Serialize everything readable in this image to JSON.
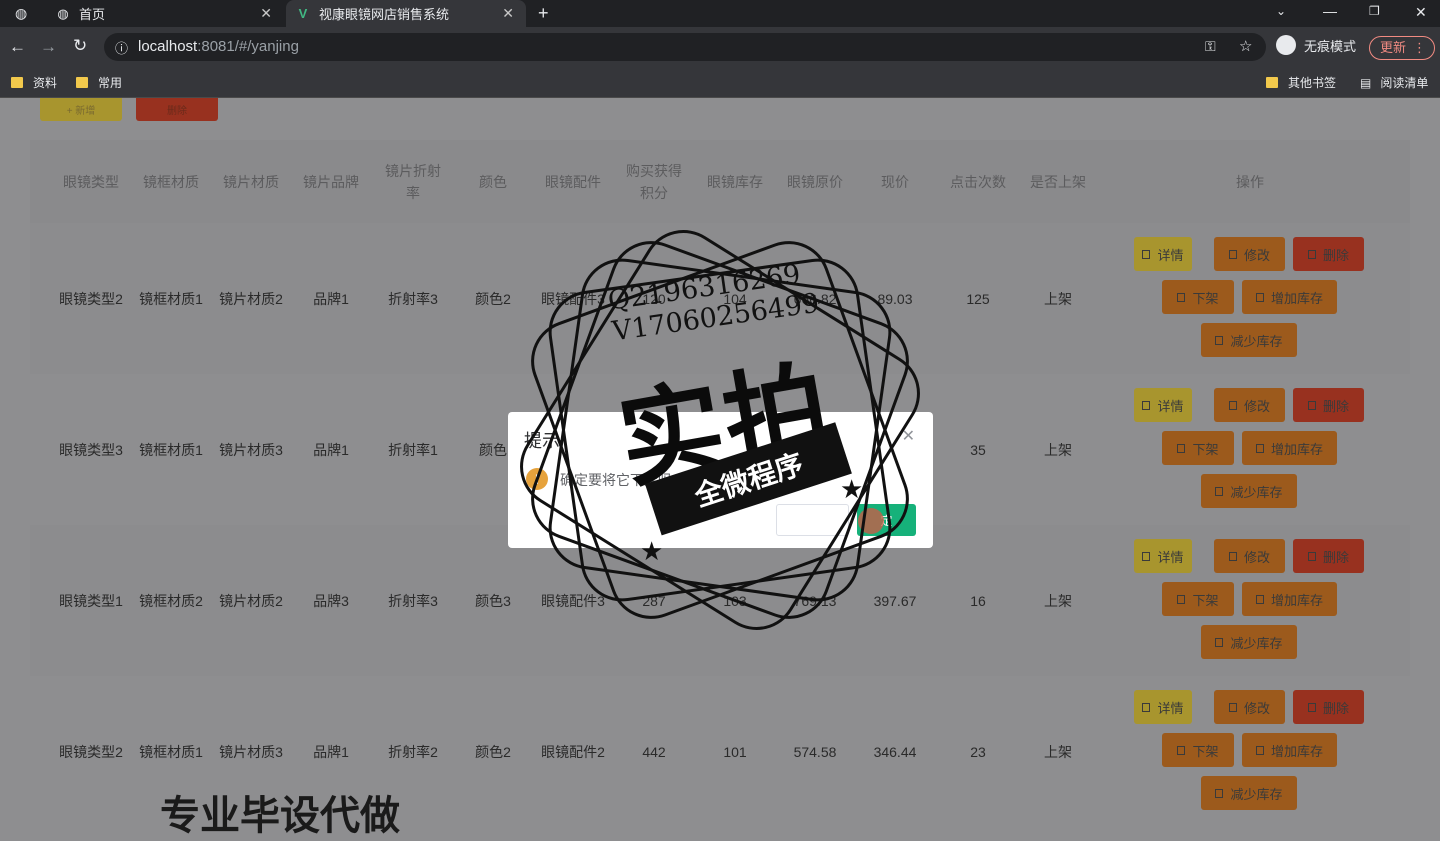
{
  "browser": {
    "tabs": [
      {
        "label": "首页"
      },
      {
        "label": "视康眼镜网店销售系统"
      }
    ],
    "url_host": "localhost",
    "url_rest": ":8081/#/yanjing",
    "incognito_label": "无痕模式",
    "update_label": "更新",
    "bookmarks": [
      {
        "label": "资料"
      },
      {
        "label": "常用"
      },
      {
        "label": "其他书签"
      },
      {
        "label": "阅读清单"
      }
    ]
  },
  "toolbar": {
    "add_label": "+ 新增",
    "delete_label": "删除"
  },
  "table": {
    "headers": [
      "眼镜类型",
      "镜框材质",
      "镜片材质",
      "镜片品牌",
      "镜片折射率",
      "颜色",
      "眼镜配件",
      "购买获得积分",
      "眼镜库存",
      "眼镜原价",
      "现价",
      "点击次数",
      "是否上架",
      "操作"
    ],
    "rows": [
      {
        "cells": [
          "眼镜类型2",
          "镜框材质1",
          "镜片材质2",
          "品牌1",
          "折射率3",
          "颜色2",
          "眼镜配件3",
          "120",
          "104",
          "666.82",
          "89.03",
          "125",
          "上架"
        ]
      },
      {
        "cells": [
          "眼镜类型3",
          "镜框材质1",
          "镜片材质3",
          "品牌1",
          "折射率1",
          "颜色",
          "",
          "",
          "",
          "",
          "",
          "35",
          "上架"
        ]
      },
      {
        "cells": [
          "眼镜类型1",
          "镜框材质2",
          "镜片材质2",
          "品牌3",
          "折射率3",
          "颜色3",
          "眼镜配件3",
          "287",
          "103",
          "769.13",
          "397.67",
          "16",
          "上架"
        ]
      },
      {
        "cells": [
          "眼镜类型2",
          "镜框材质1",
          "镜片材质3",
          "品牌1",
          "折射率2",
          "颜色2",
          "眼镜配件2",
          "442",
          "101",
          "574.58",
          "346.44",
          "23",
          "上架"
        ]
      }
    ],
    "actions": {
      "detail": "详情",
      "edit": "修改",
      "delete": "删除",
      "offshelf": "下架",
      "add_stock": "增加库存",
      "reduce_stock": "减少库存"
    }
  },
  "dialog": {
    "title": "提示",
    "message": "确定要将它下架吗?",
    "ok_label": "定"
  },
  "watermark": {
    "line1": "Q2196316269",
    "line2": "V17060256499",
    "big": "实拍",
    "ribbon": "全微程序",
    "bottom": "专业毕设代做"
  },
  "colors": {
    "confirm_green": "#16b17a",
    "warning_orange": "#e6a23c"
  }
}
